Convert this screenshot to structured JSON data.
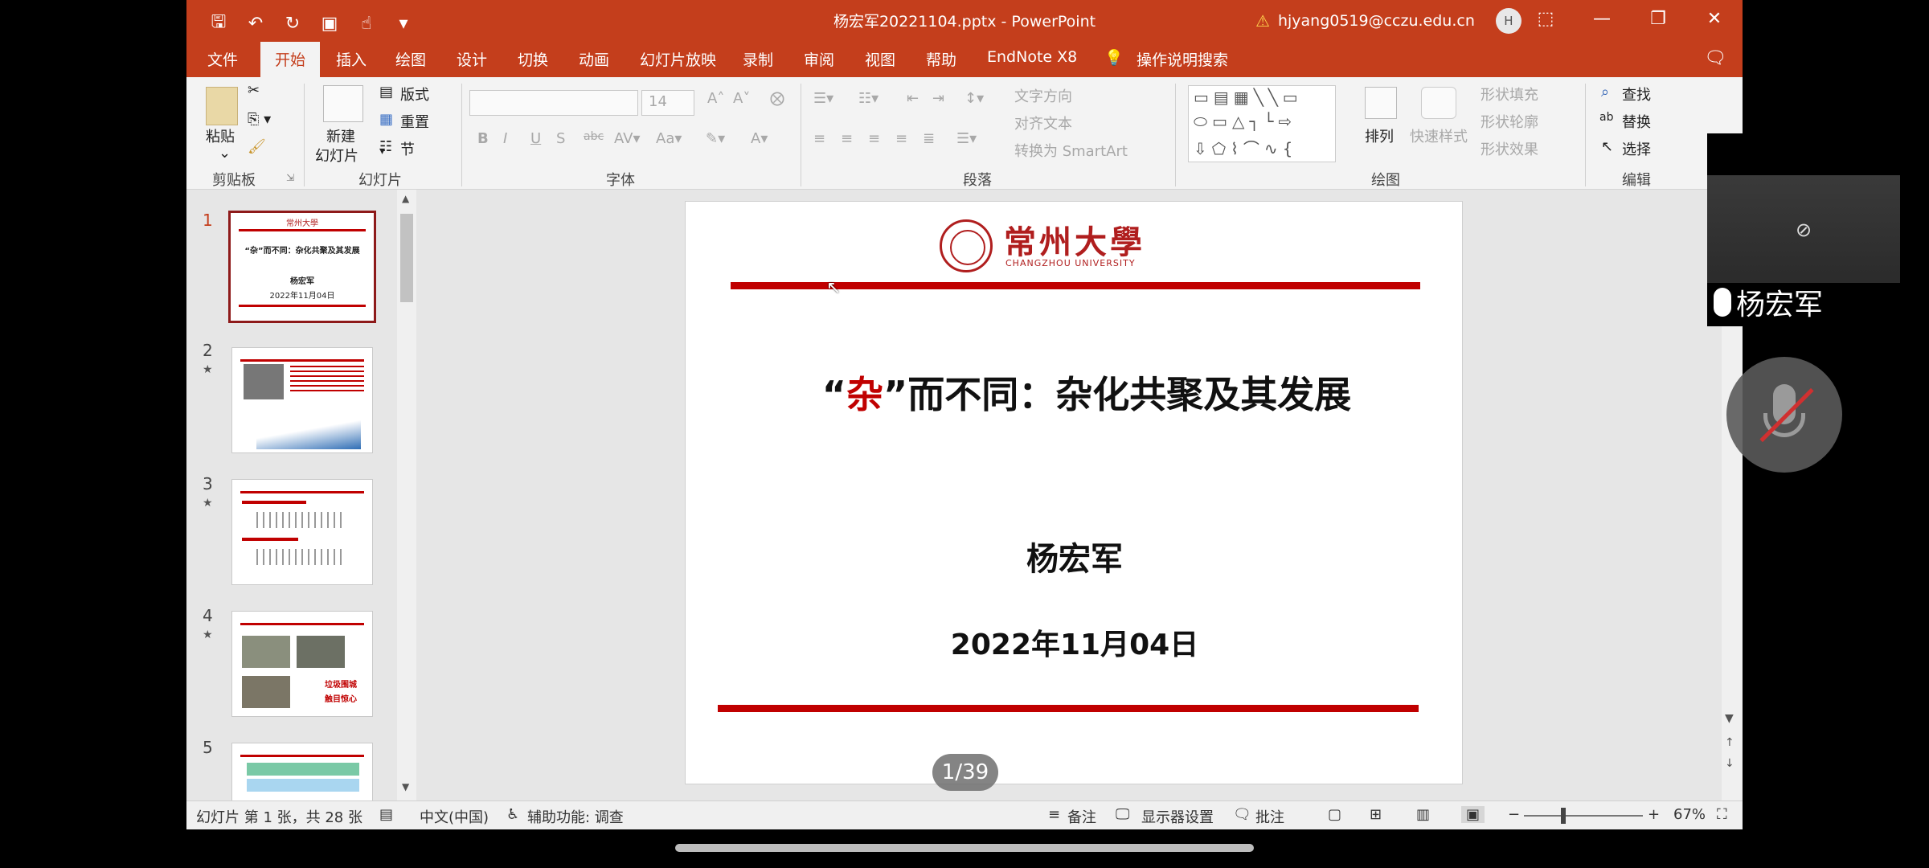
{
  "window": {
    "title": "杨宏军20221104.pptx - PowerPoint",
    "account_email": "hjyang0519@cczu.edu.cn",
    "avatar_initial": "H"
  },
  "tabs": [
    "文件",
    "开始",
    "插入",
    "绘图",
    "设计",
    "切换",
    "动画",
    "幻灯片放映",
    "录制",
    "审阅",
    "视图",
    "帮助",
    "EndNote X8",
    "操作说明搜索"
  ],
  "active_tab": "开始",
  "ribbon": {
    "clipboard": {
      "label": "剪贴板",
      "paste": "粘贴"
    },
    "slides": {
      "label": "幻灯片",
      "new_slide_1": "新建",
      "new_slide_2": "幻灯片",
      "layout": "版式",
      "reset": "重置",
      "section": "节"
    },
    "font": {
      "label": "字体",
      "size": "14"
    },
    "paragraph": {
      "label": "段落",
      "text_direction": "文字方向",
      "align_text": "对齐文本",
      "smartart": "转换为 SmartArt"
    },
    "drawing": {
      "label": "绘图",
      "arrange": "排列",
      "quick_styles": "快速样式",
      "shape_fill": "形状填充",
      "shape_outline": "形状轮廓",
      "shape_effects": "形状效果"
    },
    "editing": {
      "label": "编辑",
      "find": "查找",
      "replace": "替换",
      "select": "选择"
    }
  },
  "thumbnails": [
    {
      "num": "1",
      "title": "“杂”而不同：杂化共聚及其发展",
      "author": "杨宏军",
      "date": "2022年11月04日"
    },
    {
      "num": "2"
    },
    {
      "num": "3"
    },
    {
      "num": "4",
      "text1": "垃圾围城",
      "text2": "触目惊心"
    },
    {
      "num": "5"
    }
  ],
  "slide": {
    "logo_cn": "常州大學",
    "logo_en": "CHANGZHOU UNIVERSITY",
    "title_open": "“",
    "title_red": "杂",
    "title_rest": "”而不同：杂化共聚及其发展",
    "author": "杨宏军",
    "date": "2022年11月04日"
  },
  "page_indicator": "1/39",
  "status": {
    "slide_info": "幻灯片 第 1 张，共 28 张",
    "language": "中文(中国)",
    "accessibility": "辅助功能: 调查",
    "notes": "备注",
    "display_settings": "显示器设置",
    "comments": "批注",
    "zoom": "67%"
  },
  "meeting": {
    "participant_name": "杨宏军"
  },
  "colors": {
    "accent": "#c43e1c",
    "slide_red": "#c00000"
  }
}
